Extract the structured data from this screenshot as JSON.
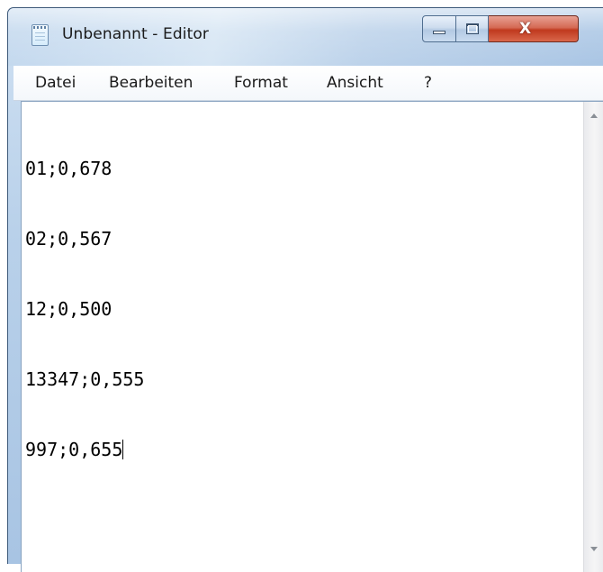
{
  "window": {
    "title": "Unbenannt - Editor",
    "icon": "notepad-icon"
  },
  "caption_buttons": {
    "minimize_icon": "minimize-icon",
    "maximize_icon": "maximize-icon",
    "close_icon": "close-icon",
    "close_glyph": "X",
    "close_color": "#c0391e"
  },
  "menu": {
    "items": [
      {
        "label": "Datei"
      },
      {
        "label": "Bearbeiten"
      },
      {
        "label": "Format"
      },
      {
        "label": "Ansicht"
      },
      {
        "label": "?"
      }
    ]
  },
  "editor": {
    "lines": [
      "01;0,678",
      "02;0,567",
      "12;0,500",
      "13347;0,555",
      "997;0,655"
    ]
  },
  "scrollbar": {
    "up_icon": "scroll-up-arrow-icon",
    "down_icon": "scroll-down-arrow-icon"
  }
}
